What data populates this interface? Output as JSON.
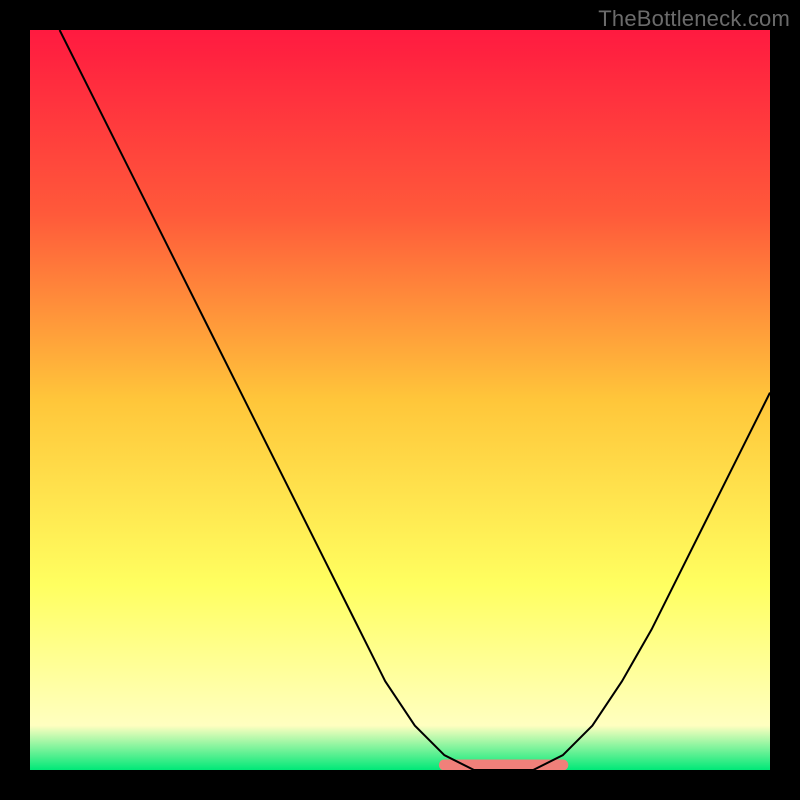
{
  "watermark_text": "TheBottleneck.com",
  "chart_data": {
    "type": "line",
    "title": "",
    "xlabel": "",
    "ylabel": "",
    "xlim": [
      0,
      100
    ],
    "ylim": [
      0,
      100
    ],
    "series": [
      {
        "name": "curve",
        "color": "#000000",
        "points": [
          {
            "x": 4,
            "y": 100
          },
          {
            "x": 8,
            "y": 92
          },
          {
            "x": 12,
            "y": 84
          },
          {
            "x": 16,
            "y": 76
          },
          {
            "x": 20,
            "y": 68
          },
          {
            "x": 24,
            "y": 60
          },
          {
            "x": 28,
            "y": 52
          },
          {
            "x": 32,
            "y": 44
          },
          {
            "x": 36,
            "y": 36
          },
          {
            "x": 40,
            "y": 28
          },
          {
            "x": 44,
            "y": 20
          },
          {
            "x": 48,
            "y": 12
          },
          {
            "x": 52,
            "y": 6
          },
          {
            "x": 56,
            "y": 2
          },
          {
            "x": 60,
            "y": 0
          },
          {
            "x": 64,
            "y": 0
          },
          {
            "x": 68,
            "y": 0
          },
          {
            "x": 72,
            "y": 2
          },
          {
            "x": 76,
            "y": 6
          },
          {
            "x": 80,
            "y": 12
          },
          {
            "x": 84,
            "y": 19
          },
          {
            "x": 88,
            "y": 27
          },
          {
            "x": 92,
            "y": 35
          },
          {
            "x": 96,
            "y": 43
          },
          {
            "x": 100,
            "y": 51
          }
        ]
      }
    ],
    "highlight_band": {
      "color": "#f0807a",
      "x_start": 56,
      "x_end": 72,
      "y": 0
    },
    "background_gradient": {
      "stops": [
        {
          "offset": 0,
          "color": "#ff1a40"
        },
        {
          "offset": 25,
          "color": "#ff5a3a"
        },
        {
          "offset": 50,
          "color": "#ffc63a"
        },
        {
          "offset": 75,
          "color": "#ffff60"
        },
        {
          "offset": 94,
          "color": "#ffffc0"
        },
        {
          "offset": 100,
          "color": "#00e878"
        }
      ]
    }
  }
}
